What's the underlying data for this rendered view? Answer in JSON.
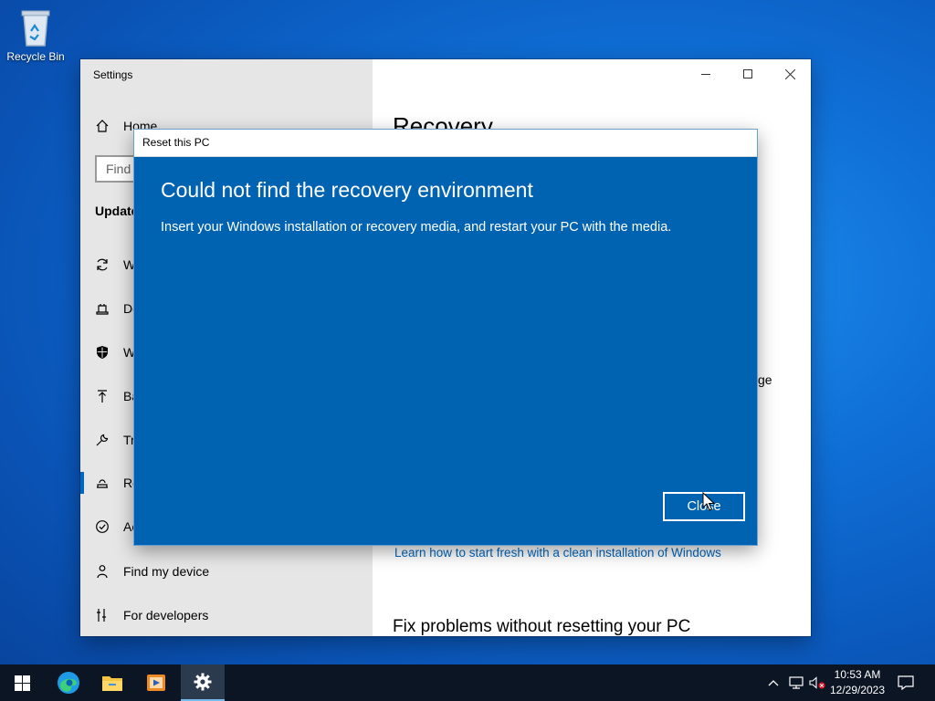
{
  "desktop": {
    "icons": [
      {
        "label": "Recycle Bin"
      }
    ]
  },
  "settings": {
    "title": "Settings",
    "nav": {
      "home": "Home",
      "search_placeholder": "Find",
      "section": "Update",
      "items": [
        {
          "label": "W",
          "icon": "sync-icon"
        },
        {
          "label": "De",
          "icon": "delivery-icon"
        },
        {
          "label": "W",
          "icon": "shield-icon"
        },
        {
          "label": "Ba",
          "icon": "backup-arrow-icon"
        },
        {
          "label": "Tr",
          "icon": "wrench-icon"
        },
        {
          "label": "Re",
          "icon": "recovery-icon",
          "selected": true
        },
        {
          "label": "Ac",
          "icon": "check-circle-icon"
        },
        {
          "label": "Find my device",
          "icon": "person-pin-icon"
        },
        {
          "label": "For developers",
          "icon": "developer-icon"
        }
      ]
    },
    "content": {
      "heading": "Recovery",
      "fragment1": "ge",
      "fragment2": "r",
      "link": "Learn how to start fresh with a clean installation of Windows",
      "subheading": "Fix problems without resetting your PC"
    }
  },
  "dialog": {
    "title": "Reset this PC",
    "heading": "Could not find the recovery environment",
    "message": "Insert your Windows installation or recovery media, and restart your PC with the media.",
    "close_label": "Close",
    "accent": "#0063b1"
  },
  "taskbar": {
    "pinned": [
      "windows-start-icon",
      "edge-icon",
      "file-explorer-icon",
      "media-player-icon",
      "settings-gear-icon"
    ],
    "time": "10:53 AM",
    "date": "12/29/2023"
  }
}
